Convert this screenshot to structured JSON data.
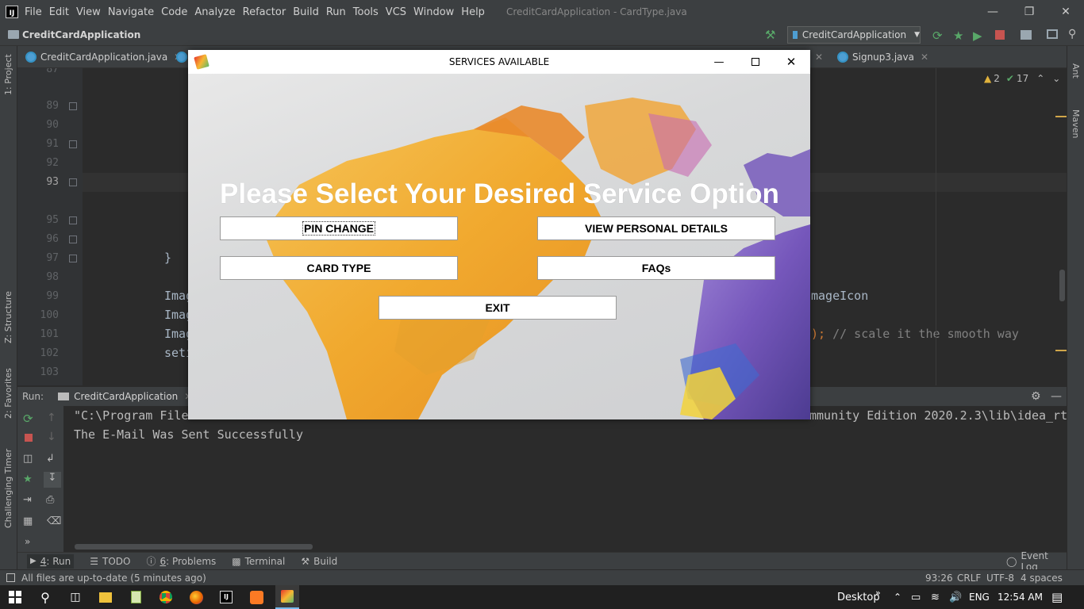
{
  "ide": {
    "menus": [
      "File",
      "Edit",
      "View",
      "Navigate",
      "Code",
      "Analyze",
      "Refactor",
      "Build",
      "Run",
      "Tools",
      "VCS",
      "Window",
      "Help"
    ],
    "window_title": "CreditCardApplication - CardType.java",
    "project_name": "CreditCardApplication",
    "run_config": "CreditCardApplication",
    "tabs": [
      "CreditCardApplication.java",
      "Signup3.java"
    ],
    "inspection": {
      "warnings": "2",
      "checks": "17"
    },
    "left_tools": [
      "1: Project",
      "Z: Structure",
      "2: Favorites",
      "Challenging Timer"
    ],
    "right_tools": [
      "Ant",
      "Maven"
    ],
    "line_numbers": [
      "87",
      "89",
      "90",
      "91",
      "92",
      "93",
      "95",
      "96",
      "97",
      "98",
      "99",
      "100",
      "101",
      "102",
      "103"
    ],
    "code": {
      "brace": "}",
      "l99_start": "Imag",
      "l99_end": "mageIcon",
      "l100_start": "Imag",
      "l101_start": "Imag",
      "l101_end_punct": ");",
      "l101_comment": "// scale it the smooth way",
      "l102_start": "seti"
    },
    "run_panel": {
      "label": "Run:",
      "tab": "CreditCardApplication",
      "line1_start": "\"C:\\Program File",
      "line1_end": "mmunity Edition 2020.2.3\\lib\\idea_rt",
      "line2": "The E-Mail Was Sent Successfully"
    },
    "bottom_tabs": {
      "run_num": "4",
      "run": ": Run",
      "todo": "TODO",
      "problems_num": "6",
      "problems": ": Problems",
      "terminal": "Terminal",
      "build": "Build",
      "event_log": "Event Log"
    },
    "status": {
      "message": "All files are up-to-date (5 minutes ago)",
      "position": "93:26",
      "line_sep": "CRLF",
      "encoding": "UTF-8",
      "indent": "4 spaces"
    }
  },
  "dialog": {
    "title": "SERVICES AVAILABLE",
    "heading": "Please Select Your Desired Service Option",
    "buttons": {
      "pin_change": "PIN CHANGE",
      "view_details": "VIEW PERSONAL DETAILS",
      "card_type": "CARD TYPE",
      "faqs": "FAQs",
      "exit": "EXIT"
    }
  },
  "taskbar": {
    "desktop": "Desktop",
    "lang": "ENG",
    "time": "12:54 AM"
  }
}
